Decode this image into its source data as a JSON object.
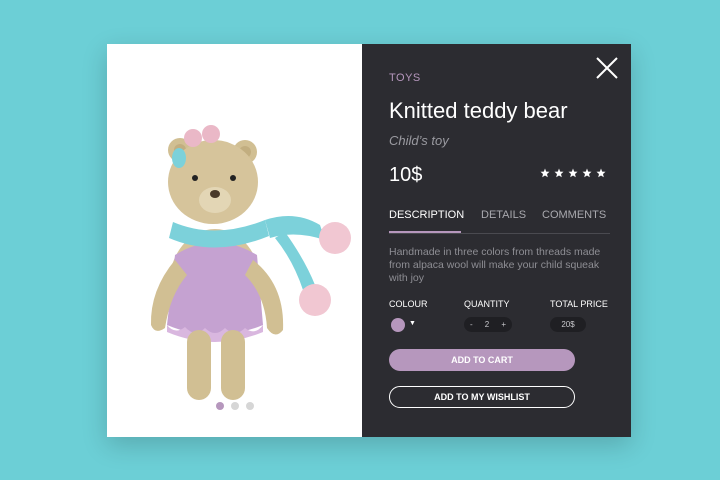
{
  "product": {
    "category": "TOYS",
    "title": "Knitted teddy bear",
    "subtitle": "Child’s toy",
    "price": "10$",
    "rating": 5,
    "description": "Handmade in three colors from threads made from alpaca wool will make your child squeak with joy"
  },
  "tabs": [
    {
      "label": "DESCRIPTION",
      "active": true
    },
    {
      "label": "DETAILS",
      "active": false
    },
    {
      "label": "COMMENTS",
      "active": false
    }
  ],
  "options": {
    "colour_label": "COLOUR",
    "quantity_label": "QUANTITY",
    "total_label": "TOTAL PRICE",
    "quantity_minus": "-",
    "quantity_value": "2",
    "quantity_plus": "+",
    "total_value": "20$",
    "selected_colour": "#b697bd"
  },
  "buttons": {
    "add_to_cart": "ADD TO CART",
    "add_to_wishlist": "ADD TO MY WISHLIST"
  },
  "carousel": {
    "count": 3,
    "active_index": 0
  },
  "icons": {
    "close": "close-icon",
    "star": "star-icon",
    "caret": "caret-down-icon"
  },
  "colors": {
    "accent": "#b697bd",
    "panel": "#2c2c31",
    "background": "#6ccfd6"
  }
}
